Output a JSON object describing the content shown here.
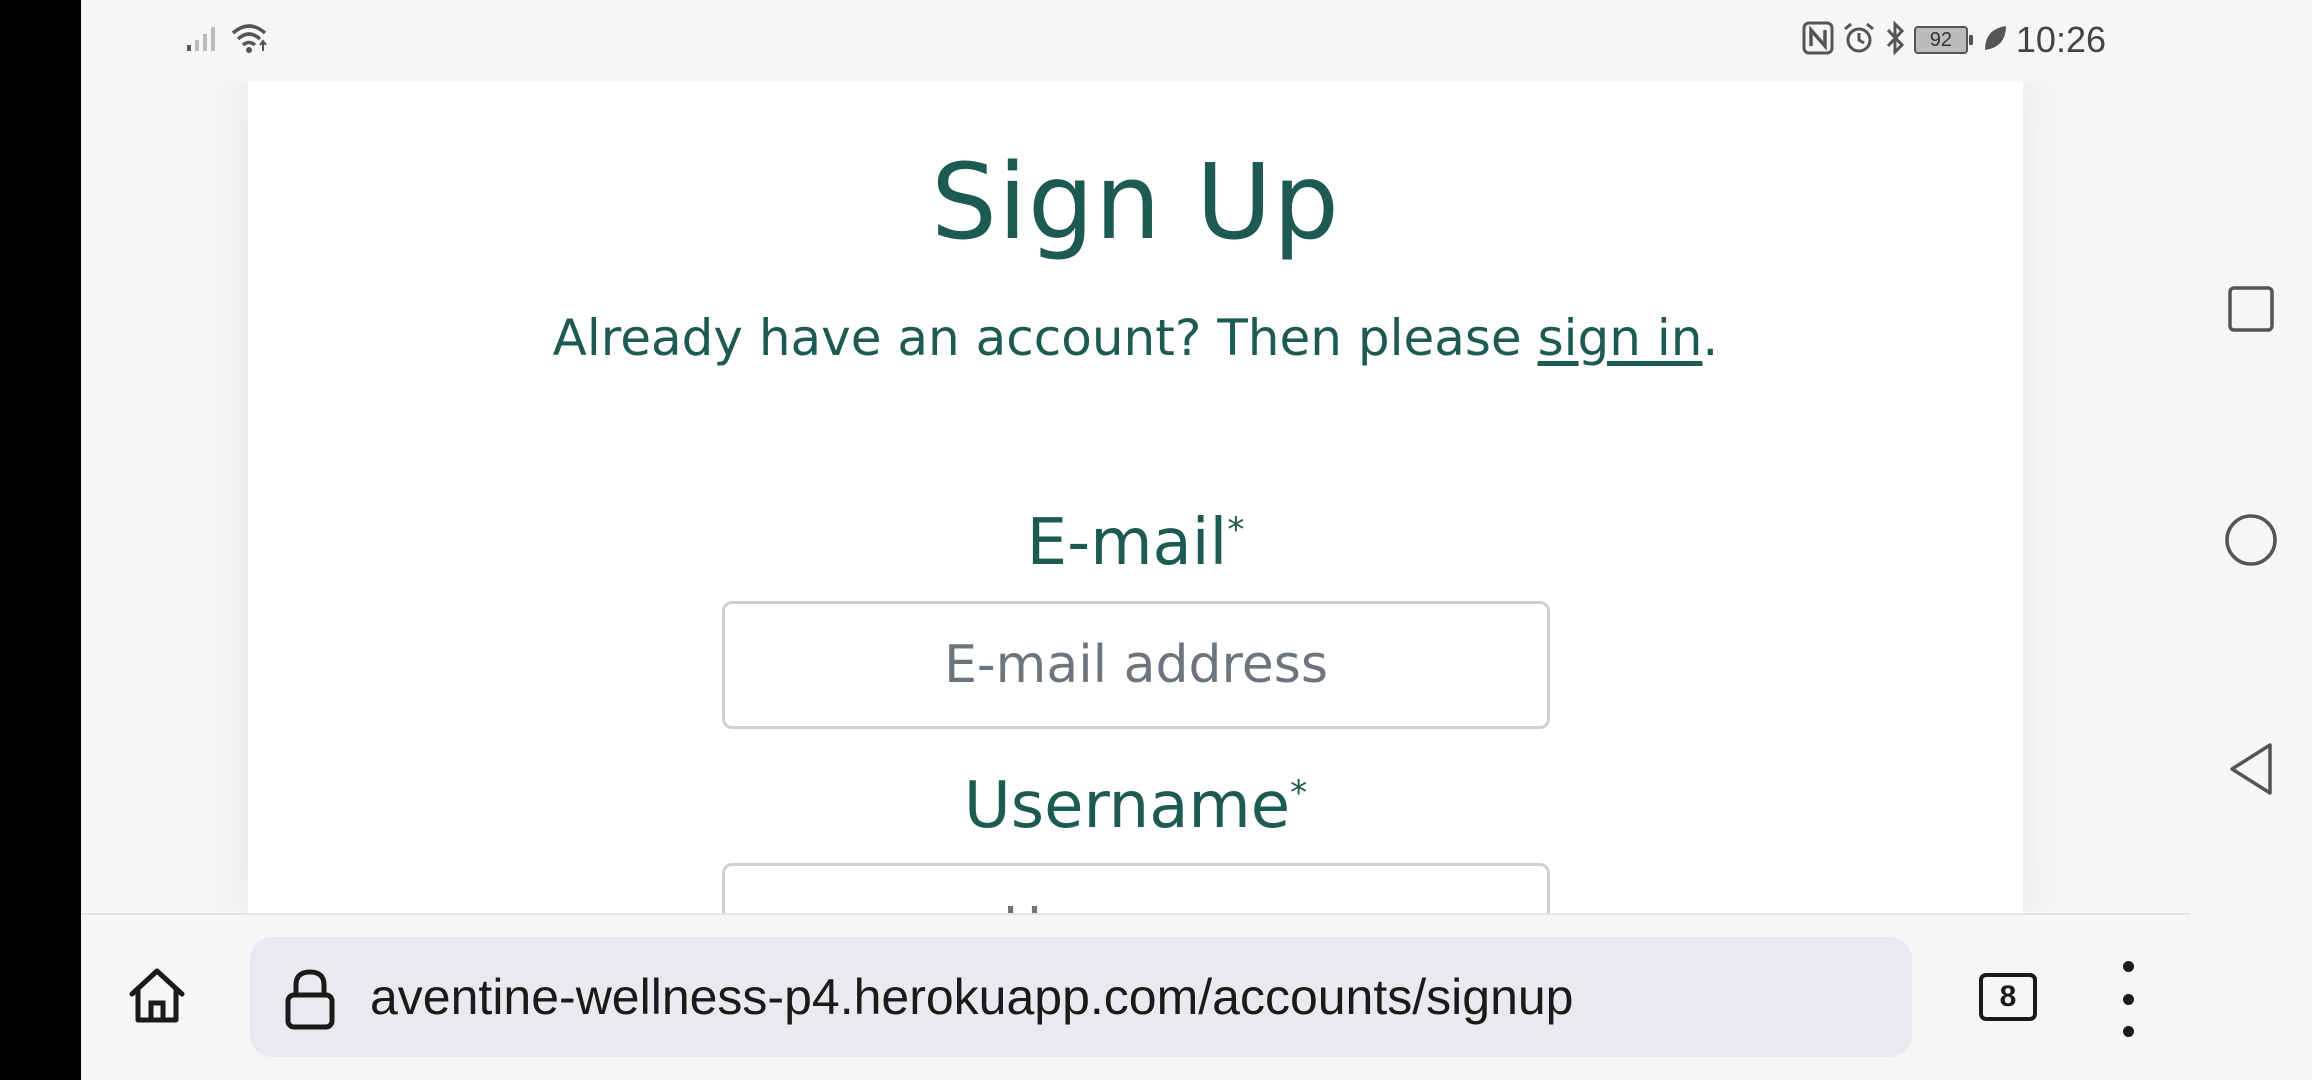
{
  "status_bar": {
    "time": "10:26",
    "battery": "92",
    "left_icons": [
      "signal-icon",
      "wifi-icon"
    ],
    "right_icons": [
      "nfc-icon",
      "alarm-icon",
      "bluetooth-icon",
      "battery-icon",
      "leaf-icon"
    ]
  },
  "page": {
    "title": "Sign Up",
    "subtitle_prefix": "Already have an account? Then please ",
    "signin_link": "sign in",
    "subtitle_suffix": ".",
    "email": {
      "label": "E-mail",
      "required_mark": "*",
      "placeholder": "E-mail address",
      "value": ""
    },
    "username": {
      "label": "Username",
      "required_mark": "*",
      "placeholder": "Username",
      "value": ""
    }
  },
  "browser": {
    "url": "aventine-wellness-p4.herokuapp.com/accounts/signup",
    "tab_count": "8",
    "icons": [
      "home-icon",
      "lock-icon",
      "tabs-icon",
      "more-menu-icon"
    ]
  },
  "nav_bar": {
    "icons": [
      "recent-apps-icon",
      "home-circle-icon",
      "back-icon"
    ]
  },
  "colors": {
    "brand_green": "#1d5a52",
    "page_bg": "#f6f6f8",
    "card_bg": "#ffffff",
    "url_bg": "#e9e9ee"
  }
}
